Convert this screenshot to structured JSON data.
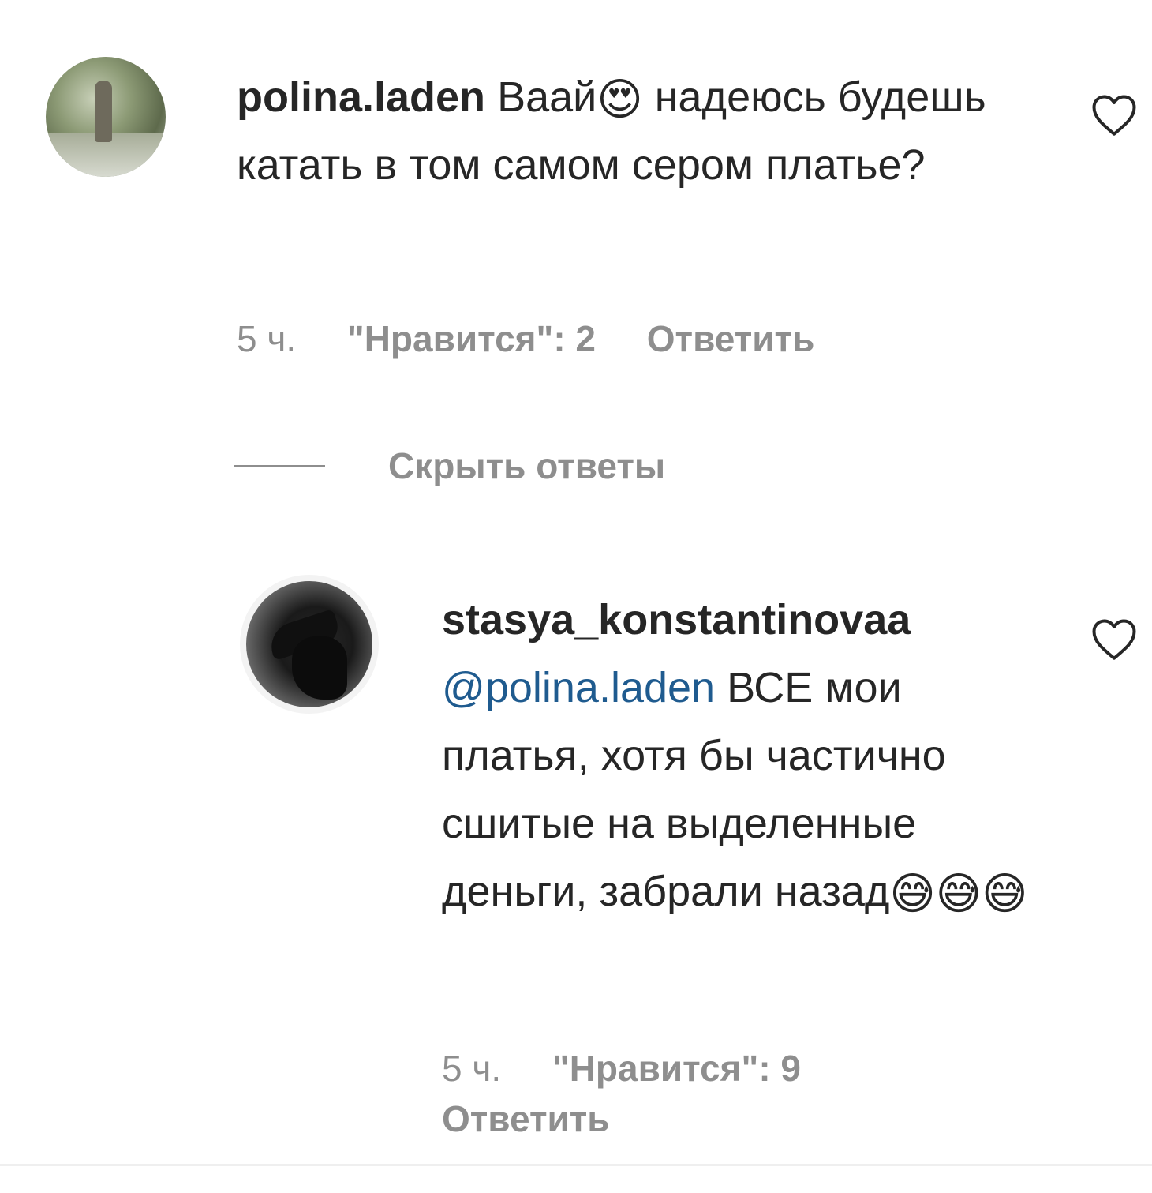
{
  "comments": [
    {
      "username": "polina.laden",
      "text_parts": {
        "before_emoji": "Ваай",
        "emoji": "😍",
        "after_emoji": " надеюсь будешь катать в том самом сером платье?"
      },
      "time": "5 ч.",
      "likes_label": "\"Нравится\": 2",
      "reply_label": "Ответить",
      "avatar_icon": "avatar-photo"
    },
    {
      "username": "stasya_konstantinovaa",
      "mention": "@polina.laden",
      "text": " ВСЕ мои платья, хотя бы частично сшитые на выделенные деньги, забрали назад",
      "emojis": "😅😅😅",
      "time": "5 ч.",
      "likes_label": "\"Нравится\": 9",
      "reply_label": "Ответить",
      "avatar_icon": "avatar-photo"
    }
  ],
  "hide_replies_label": "Скрыть ответы",
  "colors": {
    "text": "#262626",
    "secondary": "#8e8e8e",
    "mention": "#1f5b8f"
  },
  "icons": {
    "like": "heart-outline-icon"
  }
}
